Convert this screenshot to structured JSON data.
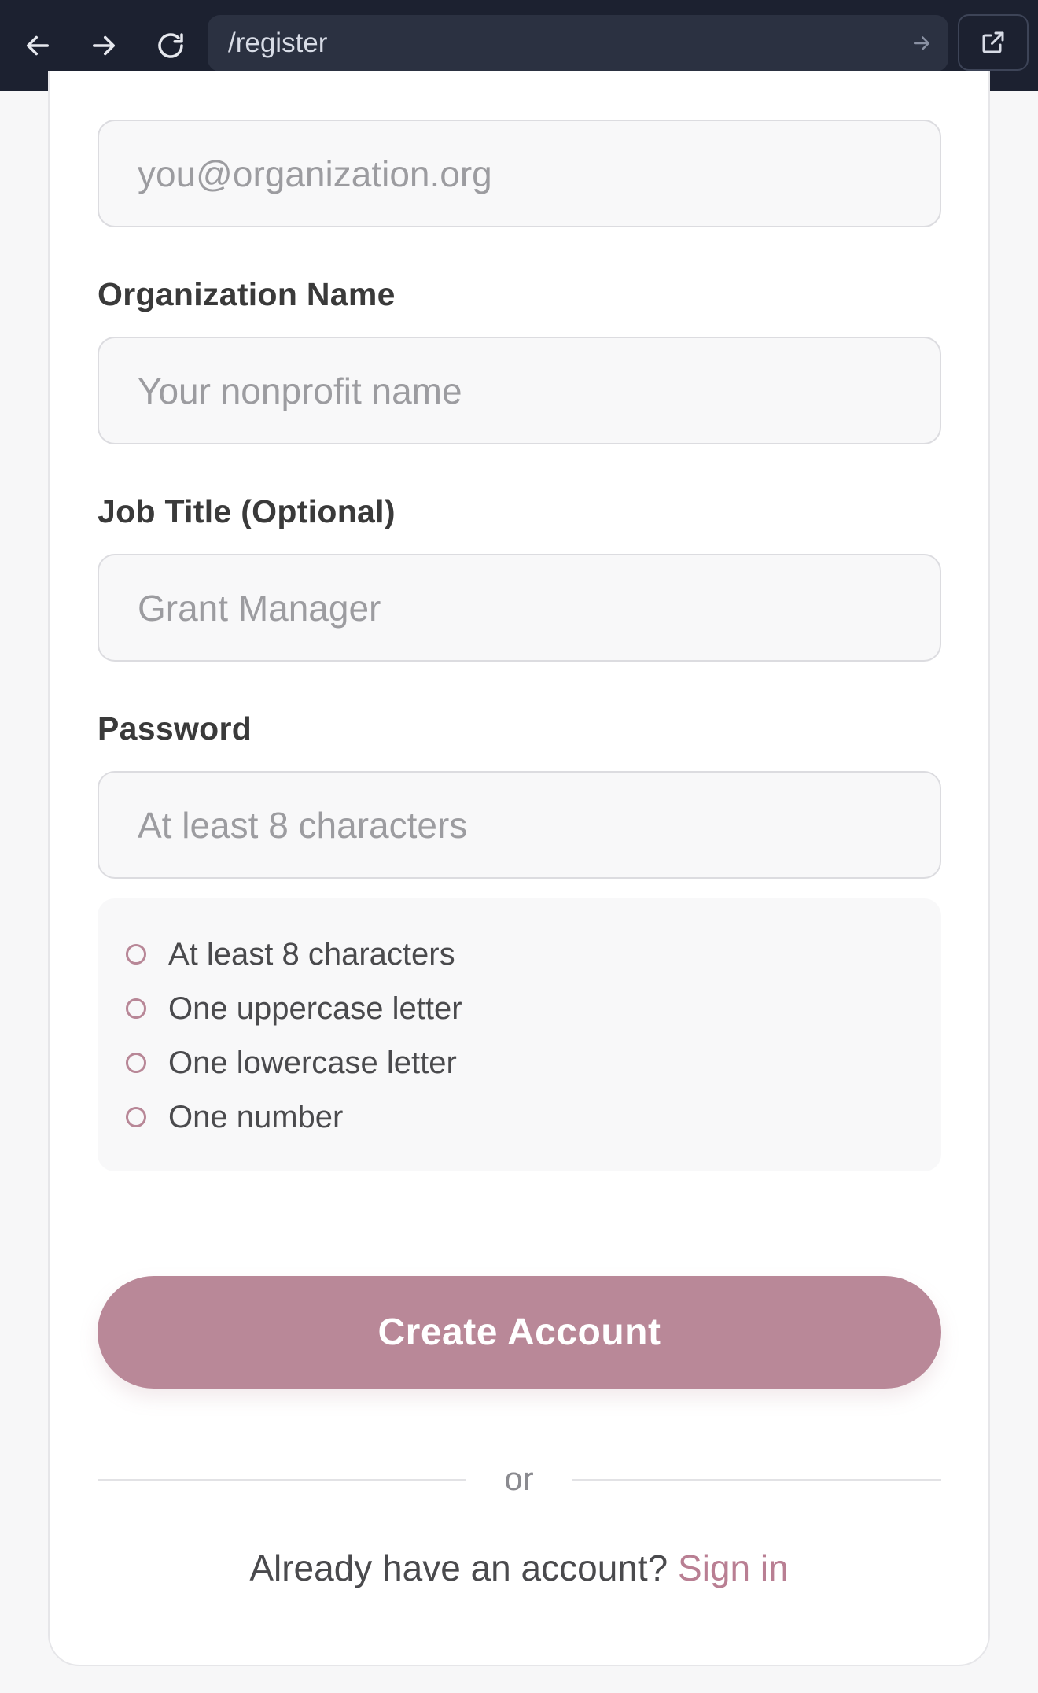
{
  "browser": {
    "url": "/register",
    "back_icon": "arrow-left-icon",
    "forward_icon": "arrow-right-icon",
    "reload_icon": "reload-icon",
    "go_icon": "arrow-right-icon",
    "open_external_icon": "external-link-icon"
  },
  "form": {
    "email": {
      "placeholder": "you@organization.org"
    },
    "organization": {
      "label": "Organization Name",
      "placeholder": "Your nonprofit name"
    },
    "job_title": {
      "label": "Job Title (Optional)",
      "placeholder": "Grant Manager"
    },
    "password": {
      "label": "Password",
      "placeholder": "At least 8 characters"
    },
    "requirements": [
      "At least 8 characters",
      "One uppercase letter",
      "One lowercase letter",
      "One number"
    ],
    "submit_label": "Create Account",
    "divider_text": "or",
    "signin_prompt": "Already have an account?",
    "signin_link": "Sign in"
  },
  "colors": {
    "accent": "#b98898",
    "link": "#b97f93",
    "topbar": "#1c2130"
  }
}
